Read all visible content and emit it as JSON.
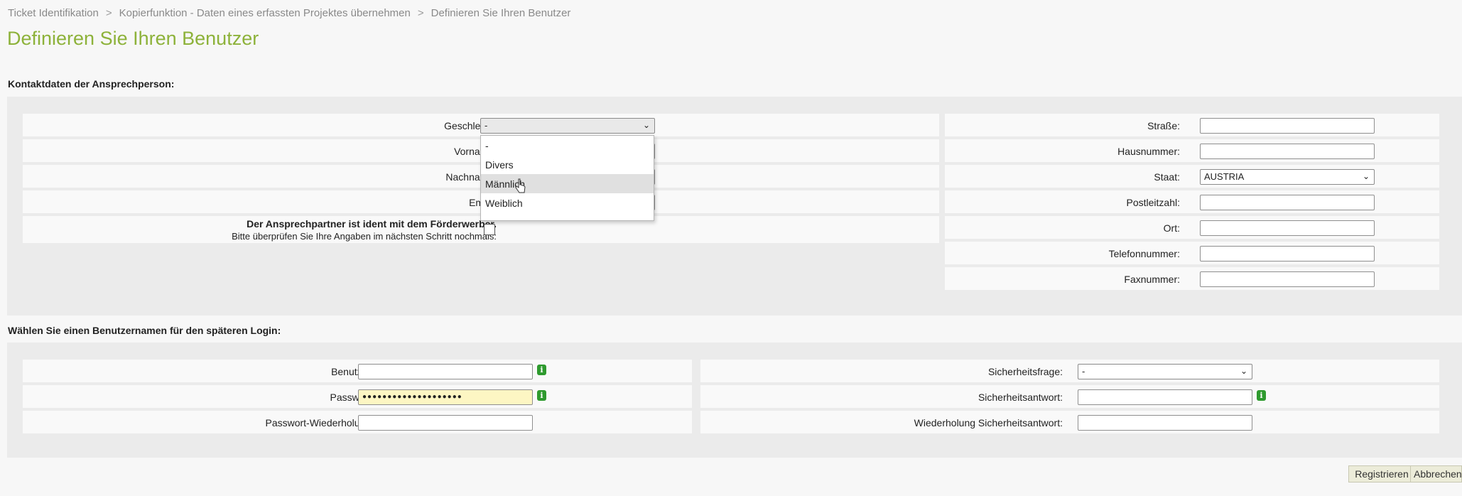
{
  "breadcrumb": [
    "Ticket Identifikation",
    "Kopierfunktion - Daten eines erfassten Projektes übernehmen",
    "Definieren Sie Ihren Benutzer"
  ],
  "breadcrumb_sep": ">",
  "page_title": "Definieren Sie Ihren Benutzer",
  "contact": {
    "heading": "Kontaktdaten der Ansprechperson:",
    "gender_label": "Geschlecht:",
    "gender_value": "-",
    "gender_options": [
      "-",
      "Divers",
      "Männlich",
      "Weiblich"
    ],
    "gender_highlighted": "Männlich",
    "firstname_label": "Vorname:",
    "lastname_label": "Nachname:",
    "email_label": "Email:",
    "ident_text": "Der Ansprechpartner ist ident mit dem Förderwerber.",
    "ident_hint": "Bitte überprüfen Sie Ihre Angaben im nächsten Schritt nochmals:",
    "street_label": "Straße:",
    "housenumber_label": "Hausnummer:",
    "country_label": "Staat:",
    "country_value": "AUSTRIA",
    "zip_label": "Postleitzahl:",
    "city_label": "Ort:",
    "phone_label": "Telefonnummer:",
    "fax_label": "Faxnummer:"
  },
  "login": {
    "heading": "Wählen Sie einen Benutzernamen für den späteren Login:",
    "user_label": "Benutzer:",
    "password_label": "Passwort:",
    "password_value": "●●●●●●●●●●●●●●●●●●●●",
    "password_repeat_label": "Passwort-Wiederholung:",
    "sec_question_label": "Sicherheitsfrage:",
    "sec_question_value": "-",
    "sec_answer_label": "Sicherheitsantwort:",
    "sec_answer_repeat_label": "Wiederholung Sicherheitsantwort:",
    "info_glyph": "i"
  },
  "buttons": {
    "register": "Registrieren",
    "cancel": "Abbrechen"
  },
  "colors": {
    "title": "#8db23a",
    "info_icon": "#2e9a2e",
    "password_bg": "#fdf6c3"
  }
}
